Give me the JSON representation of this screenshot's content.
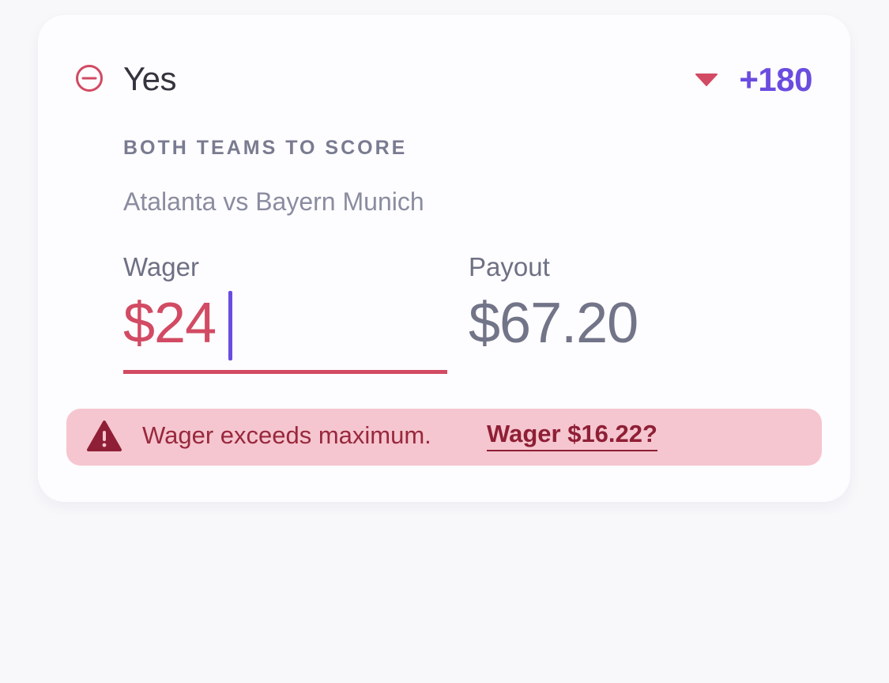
{
  "selection": {
    "name": "Yes",
    "odds": "+180",
    "market": "BOTH TEAMS TO SCORE",
    "event": "Atalanta vs Bayern Munich"
  },
  "wager": {
    "label": "Wager",
    "value": "$24"
  },
  "payout": {
    "label": "Payout",
    "value": "$67.20"
  },
  "alert": {
    "message": "Wager exceeds maximum.",
    "link": "Wager $16.22?"
  },
  "icons": {
    "remove": "minus-circle-icon",
    "odds_change": "caret-down-icon",
    "warning": "warning-triangle-icon"
  },
  "colors": {
    "accent_red": "#d24a63",
    "odds_purple": "#6a4ce0",
    "alert_bg": "#f5c6cf",
    "alert_text": "#99283d"
  }
}
